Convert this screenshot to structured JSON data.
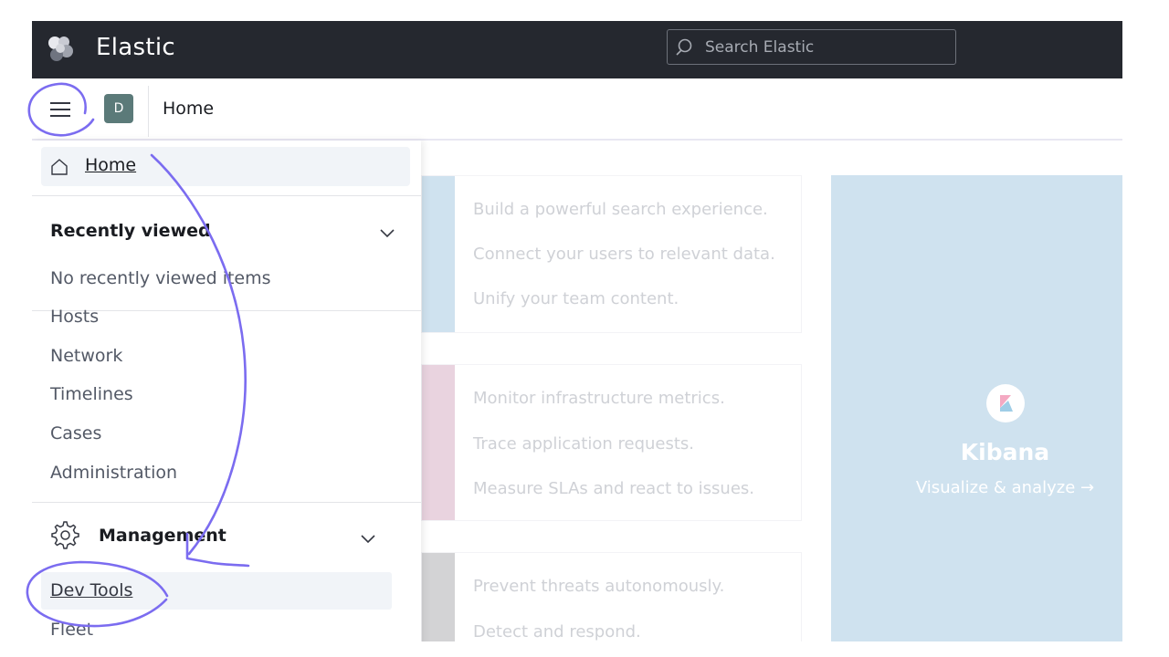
{
  "topbar": {
    "app_title": "Elastic",
    "search_placeholder": "Search Elastic",
    "icons": [
      "elastic-logo",
      "search-icon"
    ]
  },
  "header": {
    "avatar_initial": "D",
    "breadcrumb": "Home"
  },
  "nav": {
    "home_label": "Home",
    "recently_viewed": {
      "title": "Recently viewed",
      "empty_text": "No recently viewed items"
    },
    "items": [
      "Hosts",
      "Network",
      "Timelines",
      "Cases",
      "Administration"
    ],
    "management": {
      "title": "Management",
      "items": [
        "Dev Tools",
        "Fleet"
      ]
    }
  },
  "main": {
    "cards": [
      {
        "lines": [
          "Build a powerful search experience.",
          "Connect your users to relevant data.",
          "Unify your team content."
        ],
        "accent": "#cfe2ef"
      },
      {
        "lines": [
          "Monitor infrastructure metrics.",
          "Trace application requests.",
          "Measure SLAs and react to issues."
        ],
        "accent": "#e9d3df"
      },
      {
        "lines": [
          "Prevent threats autonomously.",
          "Detect and respond."
        ],
        "accent": "#d3d3d5"
      }
    ],
    "kibana": {
      "title": "Kibana",
      "link": "Visualize & analyze",
      "background": "#cfe2ef"
    }
  },
  "colors": {
    "topbar_bg": "#25282f",
    "annotation": "#7b6cf0",
    "avatar_bg": "#5b7a79"
  }
}
